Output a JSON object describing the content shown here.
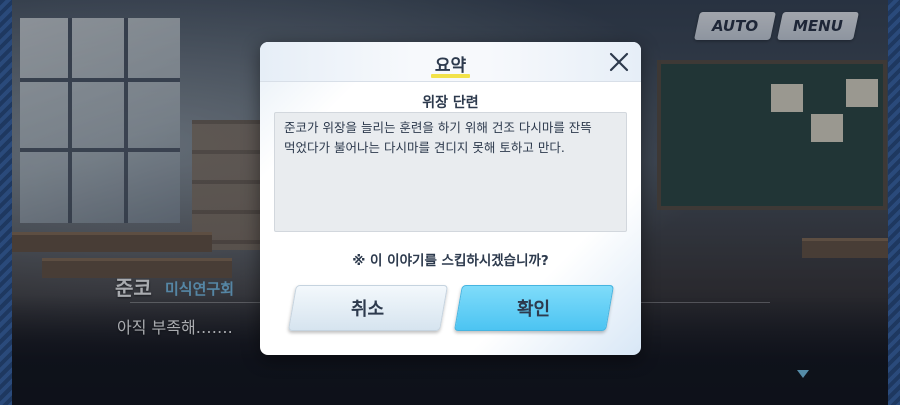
{
  "top_bar": {
    "auto_label": "AUTO",
    "menu_label": "MENU"
  },
  "dialogue": {
    "speaker_name": "준코",
    "speaker_club": "미식연구회",
    "text": "아직 부족해……."
  },
  "modal": {
    "title": "요약",
    "summary_title": "위장 단련",
    "summary_lines": [
      "준코가 위장을 늘리는 훈련을 하기 위해 건조 다시마를 잔뜩",
      "먹었다가 불어나는 다시마를 견디지 못해 토하고 만다."
    ],
    "question": "※ 이 이야기를 스킵하시겠습니까?",
    "cancel_label": "취소",
    "confirm_label": "확인"
  },
  "icons": {
    "close": "close-icon",
    "next": "next-indicator-icon"
  },
  "colors": {
    "confirm_button": "#4cc4f2",
    "title_underline": "#f2e24a",
    "speaker_club": "#7fc7f0"
  }
}
